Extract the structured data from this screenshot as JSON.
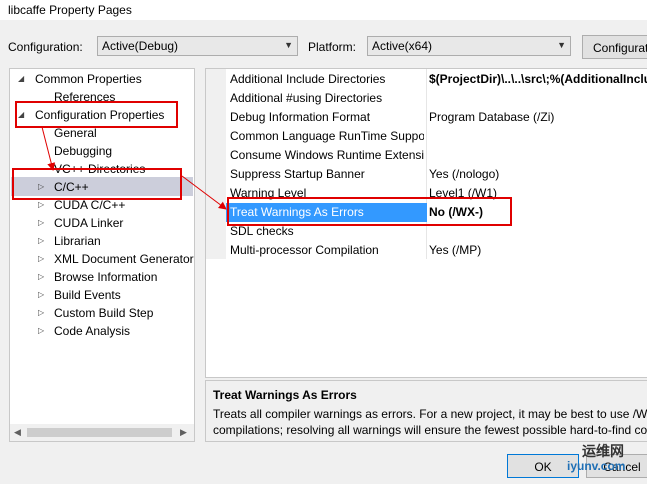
{
  "window": {
    "title": "libcaffe Property Pages"
  },
  "toolbar": {
    "configuration_label": "Configuration:",
    "configuration_value": "Active(Debug)",
    "platform_label": "Platform:",
    "platform_value": "Active(x64)",
    "config_manager_label": "Configurat"
  },
  "tree": {
    "common": "Common Properties",
    "references": "References",
    "configuration": "Configuration Properties",
    "items": [
      "General",
      "Debugging",
      "VC++ Directories",
      "C/C++",
      "CUDA C/C++",
      "CUDA Linker",
      "Librarian",
      "XML Document Generator",
      "Browse Information",
      "Build Events",
      "Custom Build Step",
      "Code Analysis"
    ]
  },
  "properties": [
    {
      "name": "Additional Include Directories",
      "value": "$(ProjectDir)\\..\\..\\src\\;%(AdditionalInclu"
    },
    {
      "name": "Additional #using Directories",
      "value": ""
    },
    {
      "name": "Debug Information Format",
      "value": "Program Database (/Zi)"
    },
    {
      "name": "Common Language RunTime Suppo",
      "value": ""
    },
    {
      "name": "Consume Windows Runtime Extensic",
      "value": ""
    },
    {
      "name": "Suppress Startup Banner",
      "value": "Yes (/nologo)"
    },
    {
      "name": "Warning Level",
      "value": "Level1 (/W1)"
    },
    {
      "name": "Treat Warnings As Errors",
      "value": "No (/WX-)"
    },
    {
      "name": "SDL checks",
      "value": ""
    },
    {
      "name": "Multi-processor Compilation",
      "value": "Yes (/MP)"
    }
  ],
  "description": {
    "title": "Treat Warnings As Errors",
    "line1": "Treats all compiler warnings as errors. For a new project, it may be best to use /WX",
    "line2": "compilations; resolving all warnings will ensure the fewest possible hard-to-find co"
  },
  "buttons": {
    "ok": "OK",
    "cancel": "Cancel"
  },
  "watermark": {
    "chinese": "运维网",
    "url": "iyunv.com"
  },
  "colors": {
    "selection": "#3399ff",
    "tree_selection": "#cccedb",
    "annotation": "#e00000"
  }
}
